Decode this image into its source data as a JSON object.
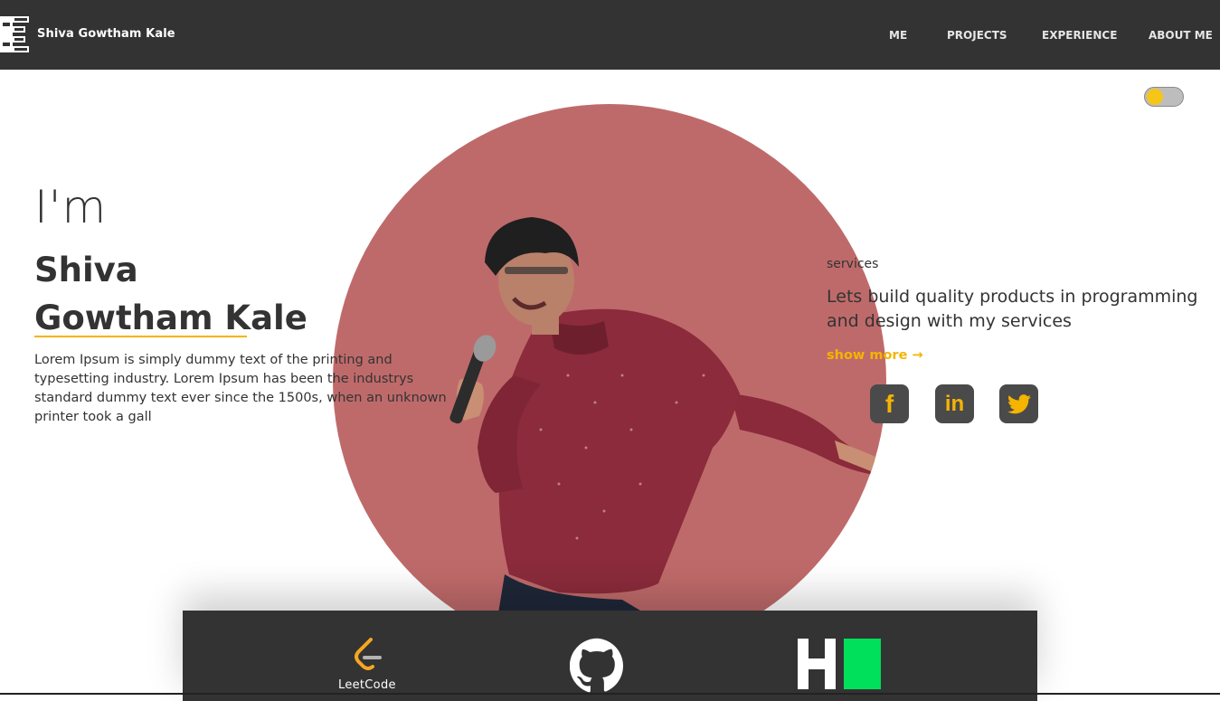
{
  "nav": {
    "brand": "Shiva Gowtham Kale",
    "links": [
      "ME",
      "PROJECTS",
      "EXPERIENCE",
      "ABOUT ME"
    ]
  },
  "theme_toggle": {
    "state": "light"
  },
  "hero": {
    "intro": "I'm",
    "name": "Shiva Gowtham Kale",
    "description": "Lorem Ipsum is simply dummy text of the printing and typesetting industry. Lorem Ipsum has been the industrys standard dummy text ever since the 1500s, when an unknown printer took a gall"
  },
  "services": {
    "label": "services",
    "text": "Lets build quality products in programming and design with my services",
    "show_more": "show more →"
  },
  "social": [
    {
      "name": "facebook-icon",
      "glyph": "f"
    },
    {
      "name": "linkedin-icon",
      "glyph": "in"
    },
    {
      "name": "twitter-icon",
      "glyph": "twitter"
    }
  ],
  "platforms": {
    "leetcode_label": "LeetCode",
    "items": [
      "leetcode-icon",
      "github-icon",
      "hackerrank-icon"
    ]
  },
  "colors": {
    "accent": "#f5b400",
    "nav_bg": "#333333",
    "circle": "#bf6a6a",
    "hackerrank_green": "#00e05a"
  }
}
